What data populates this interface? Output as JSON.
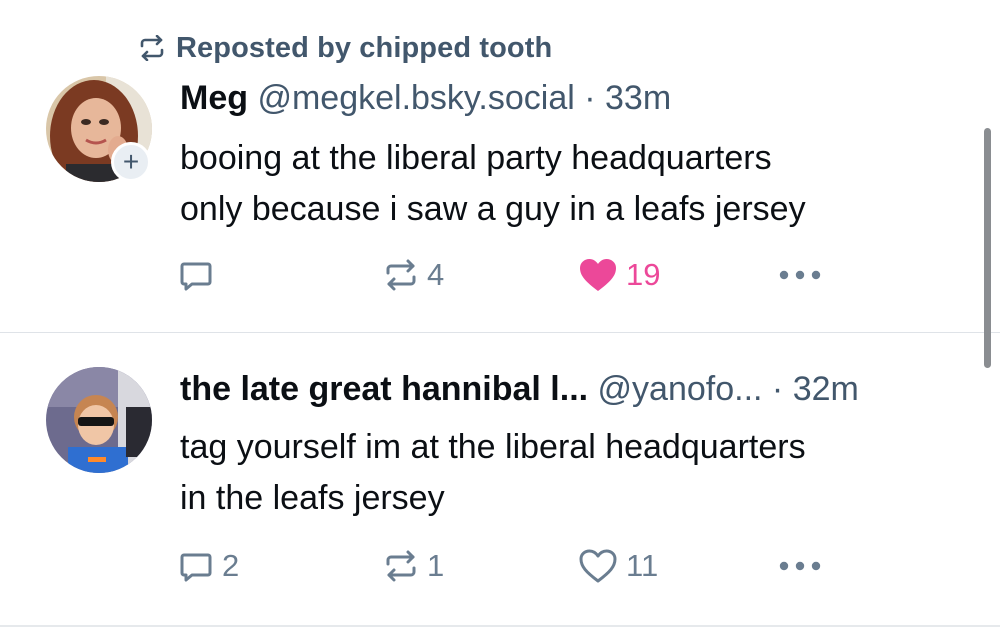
{
  "repost_banner": {
    "text": "Reposted by chipped tooth",
    "icon": "repost-icon"
  },
  "posts": [
    {
      "author_name": "Meg",
      "handle": "@megkel.bsky.social",
      "separator": " · ",
      "time": "33m",
      "text_lines": [
        "booing at the liberal party headquarters",
        "only because i saw a guy in a leafs jersey"
      ],
      "follow_badge": "+",
      "actions": {
        "reply_count": "",
        "repost_count": "4",
        "like_count": "19",
        "liked": true
      },
      "colors": {
        "like": "#ec4899"
      }
    },
    {
      "author_name": "the late great hannibal l...",
      "handle": "@yanofo...",
      "separator": " · ",
      "time": "32m",
      "text_lines": [
        "tag yourself im at the liberal headquarters",
        "in the leafs jersey"
      ],
      "actions": {
        "reply_count": "2",
        "repost_count": "1",
        "like_count": "11",
        "liked": false
      }
    }
  ],
  "colors": {
    "meta_text": "#42576c",
    "action_icon": "#6a7d90",
    "divider": "#dfe3e8"
  }
}
